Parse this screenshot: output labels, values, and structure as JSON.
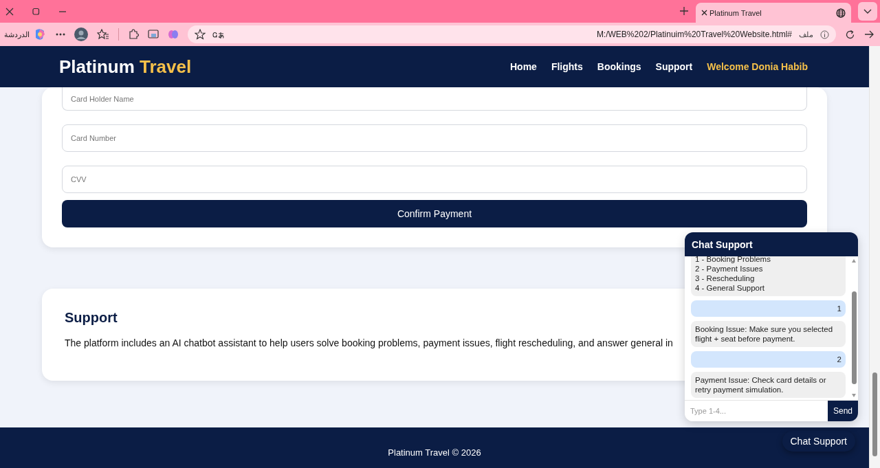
{
  "browser": {
    "tab_title": "Platinum Travel",
    "address": "M:/WEB%202/Platinuim%20Travel%20Website.html#",
    "address_label": "ملف",
    "chat_label": "الدردشة"
  },
  "header": {
    "brand": [
      {
        "text": "Platinum",
        "accent": false
      },
      {
        "text": "Travel",
        "accent": true
      }
    ],
    "nav": [
      {
        "label": "Home",
        "kind": "link"
      },
      {
        "label": "Flights",
        "kind": "link"
      },
      {
        "label": "Bookings",
        "kind": "link"
      },
      {
        "label": "Support",
        "kind": "link"
      },
      {
        "label": "Welcome Donia Habib",
        "kind": "welcome"
      }
    ]
  },
  "payment_form": {
    "fields": [
      {
        "placeholder": "Card Holder Name"
      },
      {
        "placeholder": "Card Number"
      },
      {
        "placeholder": "CVV"
      }
    ],
    "button": "Confirm Payment"
  },
  "support": {
    "title": "Support",
    "text": "The platform includes an AI chatbot assistant to help users solve booking problems, payment issues, flight rescheduling, and answer general in"
  },
  "chat": {
    "title": "Chat Support",
    "messages": [
      {
        "kind": "bot",
        "text": "1 - Booking Problems\n2 - Payment Issues\n3 - Rescheduling\n4 - General Support"
      },
      {
        "kind": "user",
        "text": "1"
      },
      {
        "kind": "bot",
        "text": "Booking Issue: Make sure you selected flight + seat before payment."
      },
      {
        "kind": "user",
        "text": "2"
      },
      {
        "kind": "bot",
        "text": "Payment Issue: Check card details or retry payment simulation."
      }
    ],
    "input_placeholder": "Type 1-4...",
    "send": "Send"
  },
  "footer": {
    "copyright": "Platinum Travel © 2026",
    "chat_button": "Chat Support"
  }
}
